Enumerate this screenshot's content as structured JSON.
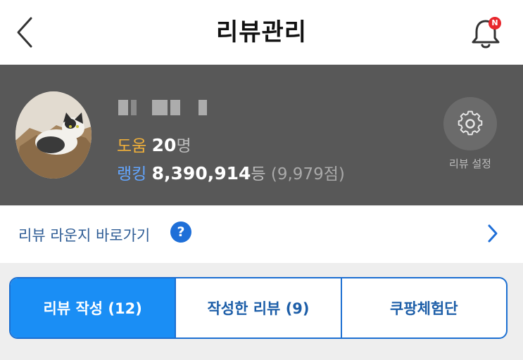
{
  "header": {
    "title": "리뷰관리",
    "back_icon": "chevron-left-icon",
    "notification_icon": "bell-icon",
    "notification_badge": "N"
  },
  "profile": {
    "help_label": "도움",
    "help_count": "20",
    "help_unit": "명",
    "rank_label": "랭킹",
    "rank_value": "8,390,914",
    "rank_unit": "등",
    "rank_points": "(9,979점)",
    "settings_label": "리뷰 설정",
    "settings_icon": "gear-icon"
  },
  "lounge": {
    "label": "리뷰 라운지 바로가기",
    "help_mark": "?",
    "arrow_icon": "chevron-right-icon"
  },
  "tabs": [
    {
      "label": "리뷰 작성 (12)",
      "active": true
    },
    {
      "label": "작성한 리뷰 (9)",
      "active": false
    },
    {
      "label": "쿠팡체험단",
      "active": false
    }
  ],
  "colors": {
    "accent": "#1a8ef5",
    "help_label": "#f2b13a",
    "rank_label": "#63a6ff",
    "badge": "#e8262c"
  }
}
